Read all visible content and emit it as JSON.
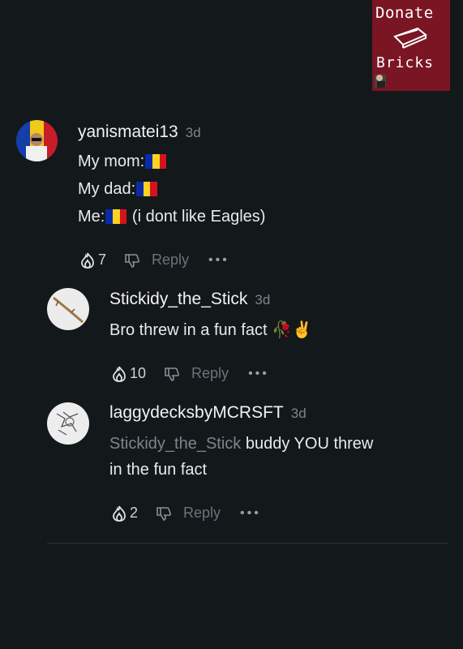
{
  "donate_banner": {
    "line1": "Donate",
    "line2": "Bricks",
    "brick_icon": "brick-icon"
  },
  "comments": [
    {
      "username": "yanismatei13",
      "time": "3d",
      "lines": [
        "My mom:",
        "My dad:",
        "Me:",
        "(i dont like Eagles)"
      ],
      "flag_colors": [
        "#0a2aa8",
        "#ffd21f",
        "#d5131f"
      ],
      "likes": "7",
      "reply_label": "Reply",
      "more_label": "•••"
    },
    {
      "username": "Stickidy_the_Stick",
      "time": "3d",
      "text": "Bro threw in a fun fact 🥀✌️",
      "likes": "10",
      "reply_label": "Reply",
      "more_label": "•••"
    },
    {
      "username": "laggydecksbyMCRSFT",
      "time": "3d",
      "mention": "Stickidy_the_Stick",
      "text_line1": " buddy YOU threw",
      "text_line2": "in the fun fact",
      "likes": "2",
      "reply_label": "Reply",
      "more_label": "•••"
    }
  ]
}
